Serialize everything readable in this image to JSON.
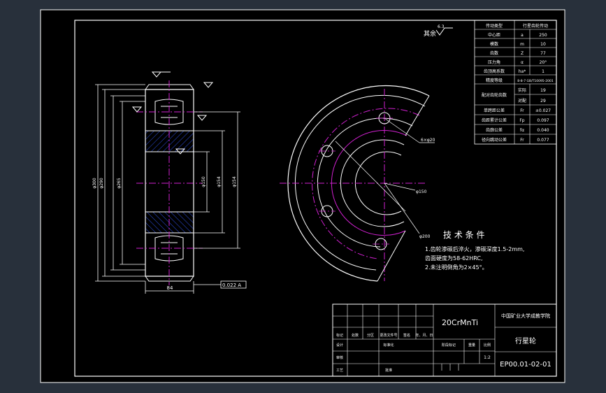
{
  "drawing": {
    "surface_finish": "其余",
    "surface_finish_value": "6.3",
    "hole_callout": "6×φ20",
    "dia_callout_1": "φ150",
    "dia_callout_2": "φ200",
    "width_dim": "84",
    "tolerance_box": "0.022 A",
    "left_dims": [
      "φ300",
      "φ290",
      "φ265",
      "φ150",
      "φ154",
      "φ154"
    ]
  },
  "tech": {
    "title": "技 术 条 件",
    "lines": [
      "1.齿轮渗碳后淬火，渗碳深度1.5-2mm,",
      "齿面硬度为58-62HRC,",
      "2.未注明倒角为2×45°。"
    ]
  },
  "params": {
    "header": [
      "传动类型",
      "行星齿轮传动"
    ],
    "rows": [
      [
        "中心距",
        "a",
        "250"
      ],
      [
        "模数",
        "m",
        "10"
      ],
      [
        "齿数",
        "Z",
        "77"
      ],
      [
        "压力角",
        "α",
        "20°"
      ],
      [
        "齿顶高系数",
        "ha*",
        "1"
      ],
      [
        "精度等级",
        "",
        "8-8-7 GB/T10095-2001"
      ],
      [
        "配对齿轮齿数",
        "实际",
        "19"
      ],
      [
        "",
        "对配",
        "29"
      ],
      [
        "单跨距公差",
        "Fr",
        "±0.027"
      ],
      [
        "齿距累计公差",
        "Fp",
        "0.097"
      ],
      [
        "齿廓公差",
        "fα",
        "0.040"
      ],
      [
        "径向跳动公差",
        "Fr",
        "0.077"
      ]
    ]
  },
  "titleblock": {
    "material": "20CrMnTi",
    "school": "中国矿业大学成教学院",
    "part_name": "行星轮",
    "drawing_no": "EP00.01-02-01",
    "labels": [
      "标记",
      "处数",
      "分区",
      "更改文件号",
      "签名",
      "年、月、日",
      "设计",
      "标准化",
      "阶段标记",
      "重量",
      "比例",
      "审核",
      "工艺",
      "批准"
    ],
    "scale": "1:2"
  }
}
